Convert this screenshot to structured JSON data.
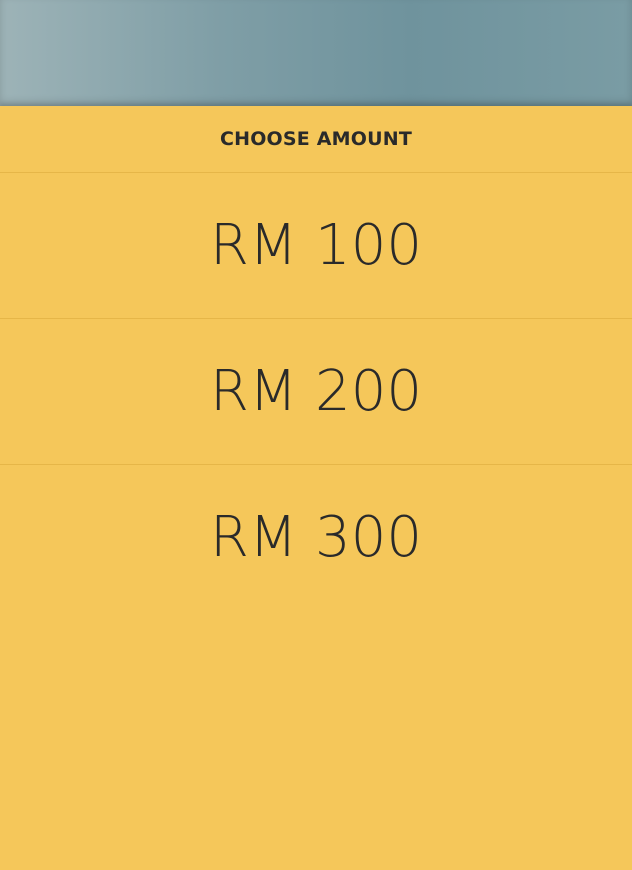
{
  "sheet": {
    "title": "CHOOSE AMOUNT",
    "options": [
      {
        "label": "RM 100"
      },
      {
        "label": "RM 200"
      },
      {
        "label": "RM 300"
      }
    ]
  },
  "colors": {
    "sheet_background": "#f5c75a",
    "text": "#2a2a2a",
    "divider": "#e6b648",
    "backdrop": "#7f9ea6"
  }
}
